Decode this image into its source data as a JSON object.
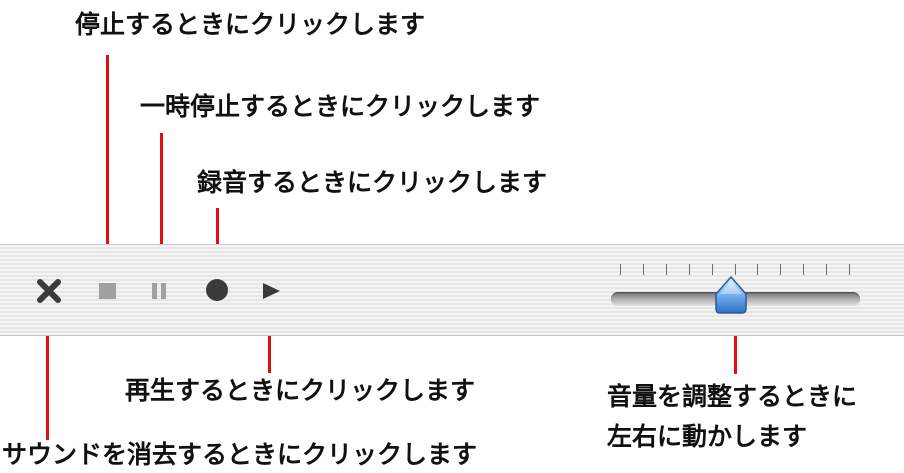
{
  "callouts": {
    "stop": "停止するときにクリックします",
    "pause": "一時停止するときにクリックします",
    "record": "録音するときにクリックします",
    "play": "再生するときにクリックします",
    "delete": "サウンドを消去するときにクリックします",
    "volume_line1": "音量を調整するときに",
    "volume_line2": "左右に動かします"
  },
  "toolbar": {
    "icons": [
      "delete-icon",
      "stop-icon",
      "pause-icon",
      "record-icon",
      "play-icon"
    ],
    "volume_level": 0.48,
    "volume_tick_count": 11
  },
  "colors": {
    "leader_line": "#e01010",
    "icon_dark": "#3a3a3a",
    "icon_disabled": "#a0a0a0",
    "thumb_blue": "#5aa2e8"
  }
}
